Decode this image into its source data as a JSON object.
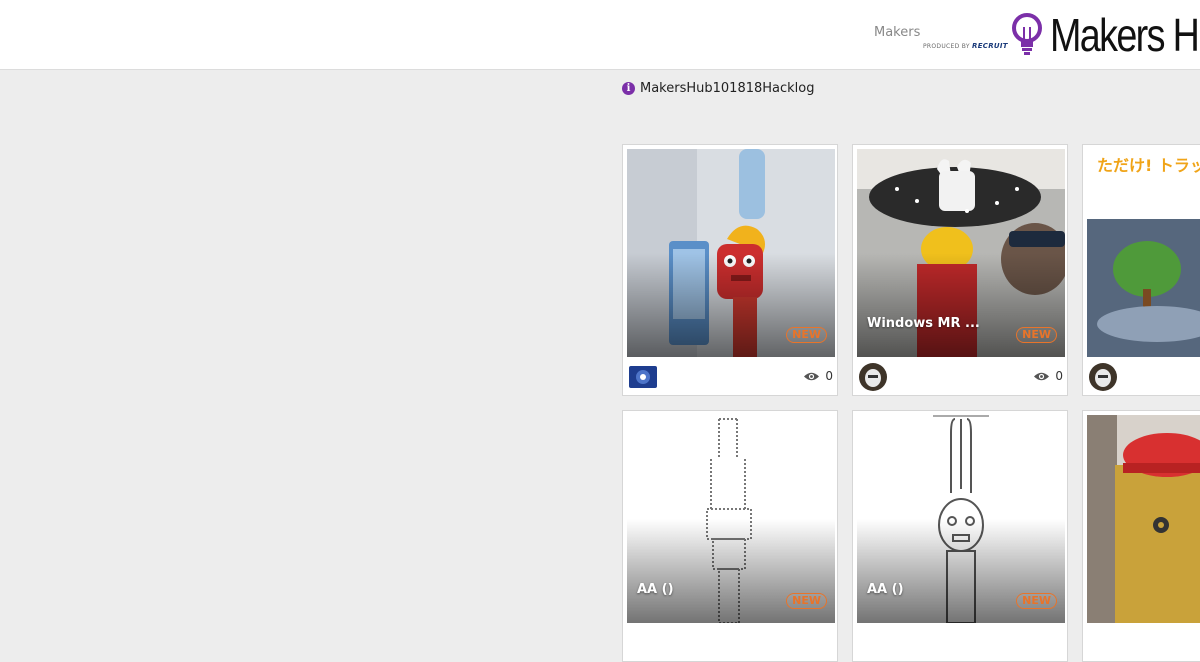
{
  "header": {
    "nav_link": "Makers",
    "produced_by": "PRODUCED BY",
    "produced_brand": "RECRUIT",
    "logo_text": "Makers H"
  },
  "notice": {
    "icon": "info-icon",
    "text": "MakersHub101818Hacklog"
  },
  "cards": [
    {
      "title": "",
      "badge": "NEW",
      "views": "0",
      "icon": "eye-icon"
    },
    {
      "title": "Windows MR ...",
      "badge": "NEW",
      "views": "0",
      "icon": "eye-icon"
    },
    {
      "title": "",
      "badge": "",
      "views": "",
      "image_text": "ただけ! トラッピー"
    },
    {
      "title": "AA ()",
      "badge": "NEW"
    },
    {
      "title": "AA ()",
      "badge": "NEW"
    },
    {
      "title": "",
      "badge": ""
    }
  ],
  "colors": {
    "accent_badge": "#e8742a",
    "logo_purple": "#7b2fa8",
    "background": "#ededed"
  }
}
